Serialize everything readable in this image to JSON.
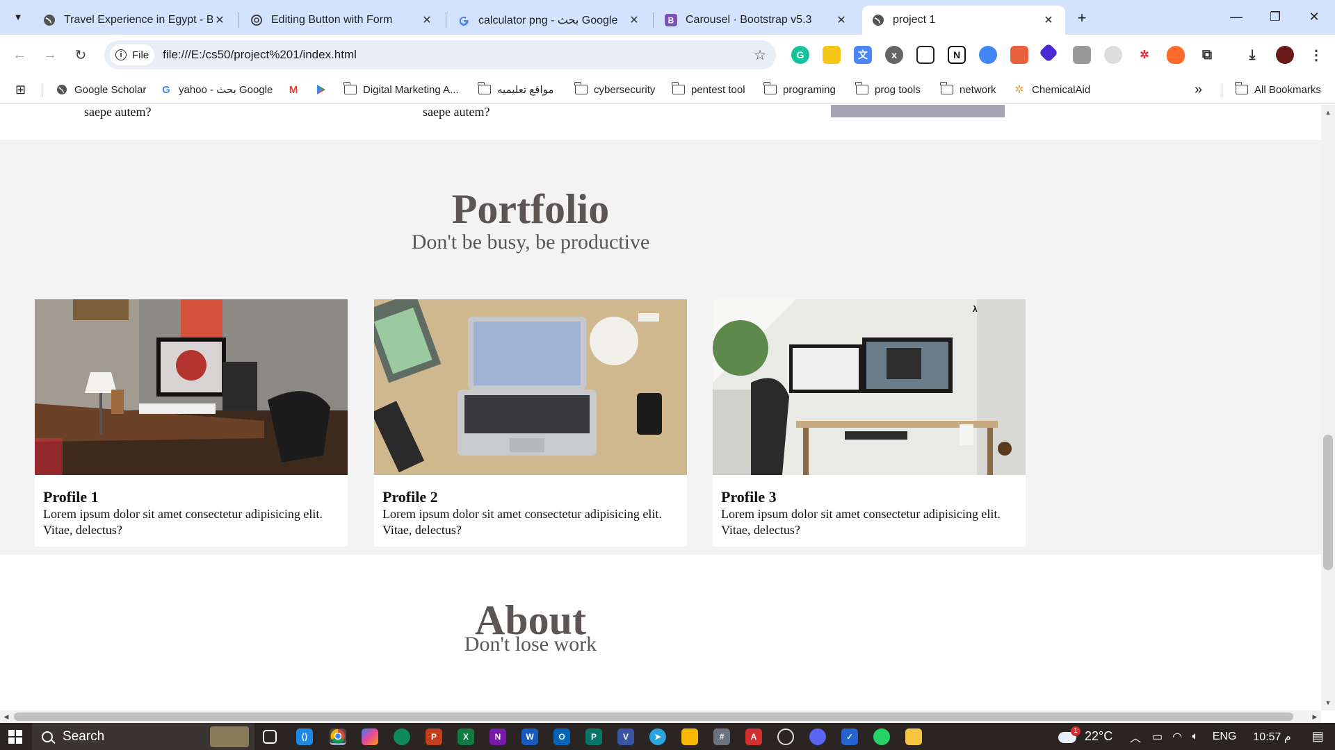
{
  "browser": {
    "tabs": [
      {
        "title": "Travel Experience in Egypt - Blo",
        "icon": "globe-icon",
        "active": false
      },
      {
        "title": "Editing Button with Form",
        "icon": "openai-icon",
        "active": false
      },
      {
        "title": "calculator png - بحث Google",
        "icon": "google-icon",
        "active": false
      },
      {
        "title": "Carousel · Bootstrap v5.3",
        "icon": "bootstrap-icon",
        "active": false
      },
      {
        "title": "project 1",
        "icon": "globe-icon",
        "active": true
      }
    ],
    "new_tab": "+",
    "window_controls": {
      "minimize": "—",
      "restore": "❐",
      "close": "✕"
    },
    "address": {
      "scheme_chip": "File",
      "url": "file:///E:/cs50/project%201/index.html"
    },
    "bookmarks": [
      {
        "label": "Google Scholar",
        "icon": "globe-icon"
      },
      {
        "label": "yahoo - بحث Google",
        "icon": "google-icon"
      },
      {
        "label": "",
        "icon": "gmail-icon"
      },
      {
        "label": "",
        "icon": "play-store-icon"
      },
      {
        "label": "Digital Marketing A...",
        "icon": "folder-icon"
      },
      {
        "label": "مواقع تعليميه",
        "icon": "folder-icon"
      },
      {
        "label": "cybersecurity",
        "icon": "folder-icon"
      },
      {
        "label": "pentest tool",
        "icon": "folder-icon"
      },
      {
        "label": "programing",
        "icon": "folder-icon"
      },
      {
        "label": "prog tools",
        "icon": "folder-icon"
      },
      {
        "label": "network",
        "icon": "folder-icon"
      },
      {
        "label": "ChemicalAid",
        "icon": "chemicalaid-icon"
      }
    ],
    "bookmarks_overflow": "»",
    "all_bookmarks": "All Bookmarks"
  },
  "page": {
    "prev_section": {
      "text_left": "saepe autem?",
      "text_mid": "saepe autem?"
    },
    "portfolio": {
      "title": "Portfolio",
      "subtitle": "Don't be busy, be productive",
      "cards": [
        {
          "title": "Profile 1",
          "text": "Lorem ipsum dolor sit amet consectetur adipisicing elit. Vitae, delectus?"
        },
        {
          "title": "Profile 2",
          "text": "Lorem ipsum dolor sit amet consectetur adipisicing elit. Vitae, delectus?"
        },
        {
          "title": "Profile 3",
          "text": "Lorem ipsum dolor sit amet consectetur adipisicing elit. Vitae, delectus?"
        }
      ]
    },
    "about": {
      "title": "About",
      "subtitle": "Don't lose work"
    }
  },
  "taskbar": {
    "search_label": "Search",
    "weather": "22°C",
    "weather_badge": "1",
    "language": "ENG",
    "time": "10:57 م"
  }
}
